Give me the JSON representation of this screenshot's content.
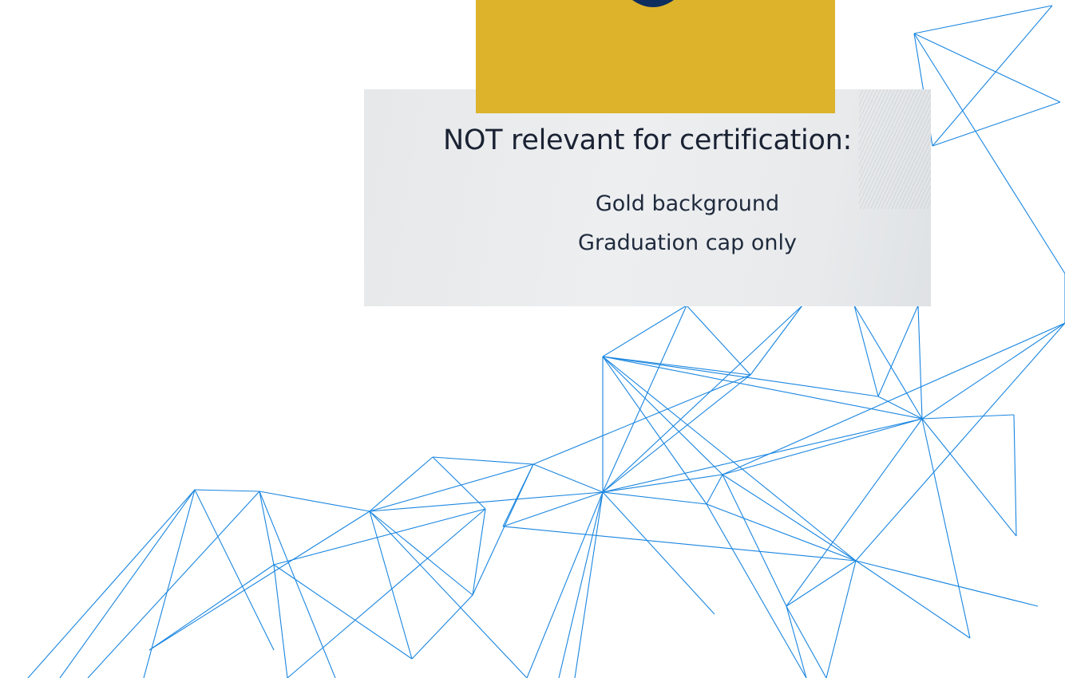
{
  "card": {
    "heading": "NOT relevant for certification:",
    "lines": [
      "Gold background",
      "Graduation cap only"
    ]
  },
  "icons": {
    "cap": "graduation-cap-icon"
  },
  "colors": {
    "gold": "#dcb32a",
    "navy": "#0d2d5e",
    "network_lines": "#1a86e0",
    "card_background": "#e9ebed",
    "text": "#1a2233"
  }
}
